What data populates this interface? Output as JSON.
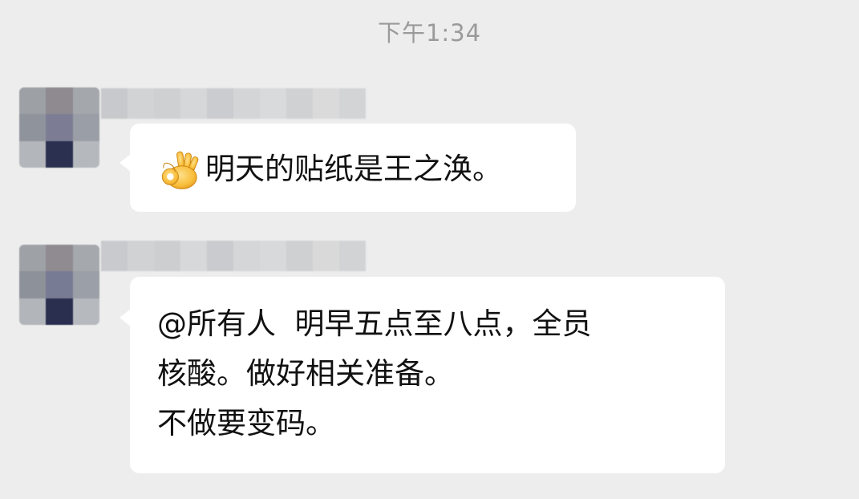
{
  "chat": {
    "timestamp": "下午1:34",
    "messages": [
      {
        "sender_name": "",
        "emoji": "ok-hand",
        "text": "明天的贴纸是王之涣。"
      },
      {
        "sender_name": "",
        "lines": [
          "@所有人  明早五点至八点，全员",
          "核酸。做好相关准备。",
          "不做要变码。"
        ]
      }
    ]
  },
  "colors": {
    "background": "#ededed",
    "bubble": "#ffffff",
    "timestamp_text": "#9a9a9a",
    "message_text": "#111111"
  },
  "icons": {
    "message_1_emoji": "ok-hand-icon"
  }
}
